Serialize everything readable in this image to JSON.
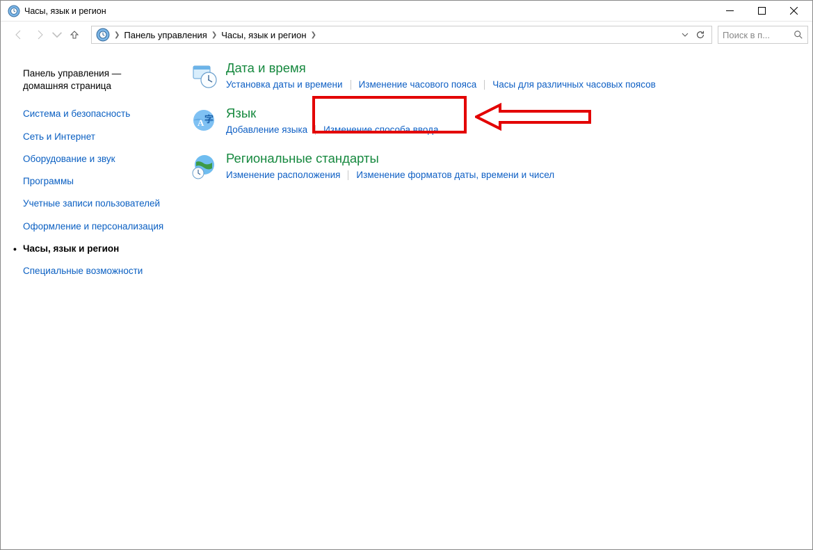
{
  "window": {
    "title": "Часы, язык и регион"
  },
  "breadcrumb": {
    "root": "Панель управления",
    "current": "Часы, язык и регион"
  },
  "search": {
    "placeholder": "Поиск в п..."
  },
  "sidebar": {
    "home": "Панель управления — домашняя страница",
    "items": [
      "Система и безопасность",
      "Сеть и Интернет",
      "Оборудование и звук",
      "Программы",
      "Учетные записи пользователей",
      "Оформление и персонализация",
      "Часы, язык и регион",
      "Специальные возможности"
    ],
    "active_index": 6
  },
  "categories": [
    {
      "title": "Дата и время",
      "links": [
        "Установка даты и времени",
        "Изменение часового пояса",
        "Часы для различных часовых поясов"
      ]
    },
    {
      "title": "Язык",
      "links": [
        "Добавление языка",
        "Изменение способа ввода"
      ]
    },
    {
      "title": "Региональные стандарты",
      "links": [
        "Изменение расположения",
        "Изменение форматов даты, времени и чисел"
      ]
    }
  ]
}
